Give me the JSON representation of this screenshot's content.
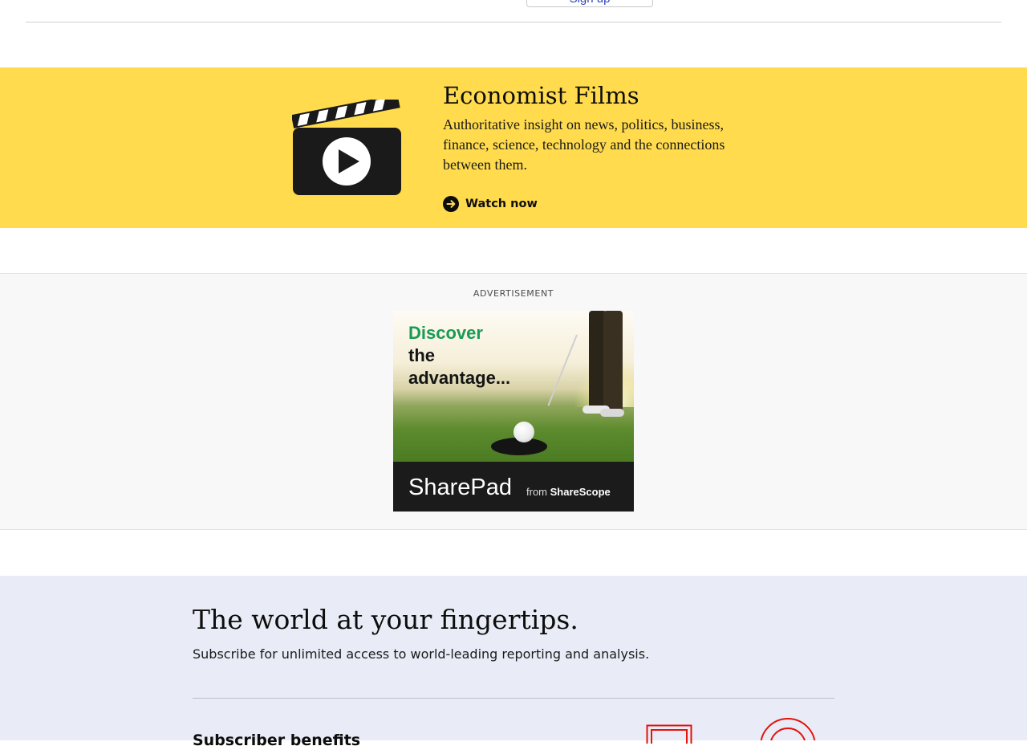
{
  "top": {
    "button_label": "Sign up"
  },
  "films": {
    "title": "Economist Films",
    "description": "Authoritative insight on news, politics, business, finance, science, technology and the connections between them.",
    "cta_label": "Watch now"
  },
  "advertisement": {
    "label": "ADVERTISEMENT",
    "headline_line1": "Discover",
    "headline_line2": "the",
    "headline_line3": "advantage...",
    "brand": "SharePad",
    "from_text": "from",
    "from_brand": "ShareScope"
  },
  "subscribe": {
    "title": "The world at your fingertips.",
    "description": "Subscribe for unlimited access to world-leading reporting and analysis.",
    "benefits_heading": "Subscriber benefits"
  },
  "colors": {
    "films_banner": "#ffdb4d",
    "subscribe_bg": "#e9ecf6",
    "ad_green": "#1a9a55",
    "accent_red": "#e3120b"
  }
}
